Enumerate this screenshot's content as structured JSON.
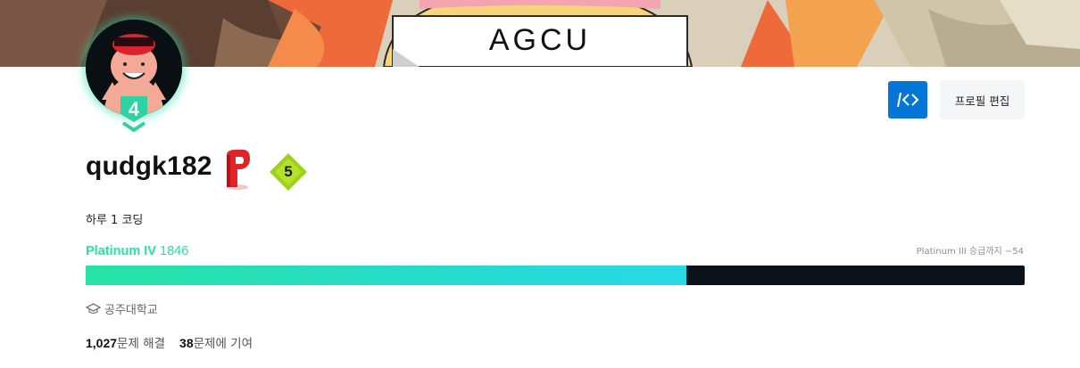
{
  "banner": {
    "text": "AGCU"
  },
  "profile": {
    "username": "qudgk182",
    "bio": "하루 1 코딩",
    "level": "4",
    "class": "5",
    "school": "공주대학교"
  },
  "buttons": {
    "code_icon": "code-icon",
    "edit_label": "프로필 편집"
  },
  "tier": {
    "name": "Platinum IV",
    "rating": "1846",
    "next": "Platinum III 승급까지 −54",
    "progress_percent": 64,
    "accent": "#27e2a4"
  },
  "stats": {
    "solved_count": "1,027",
    "solved_label": "문제 해결",
    "contrib_count": "38",
    "contrib_label": "문제에 기여"
  }
}
